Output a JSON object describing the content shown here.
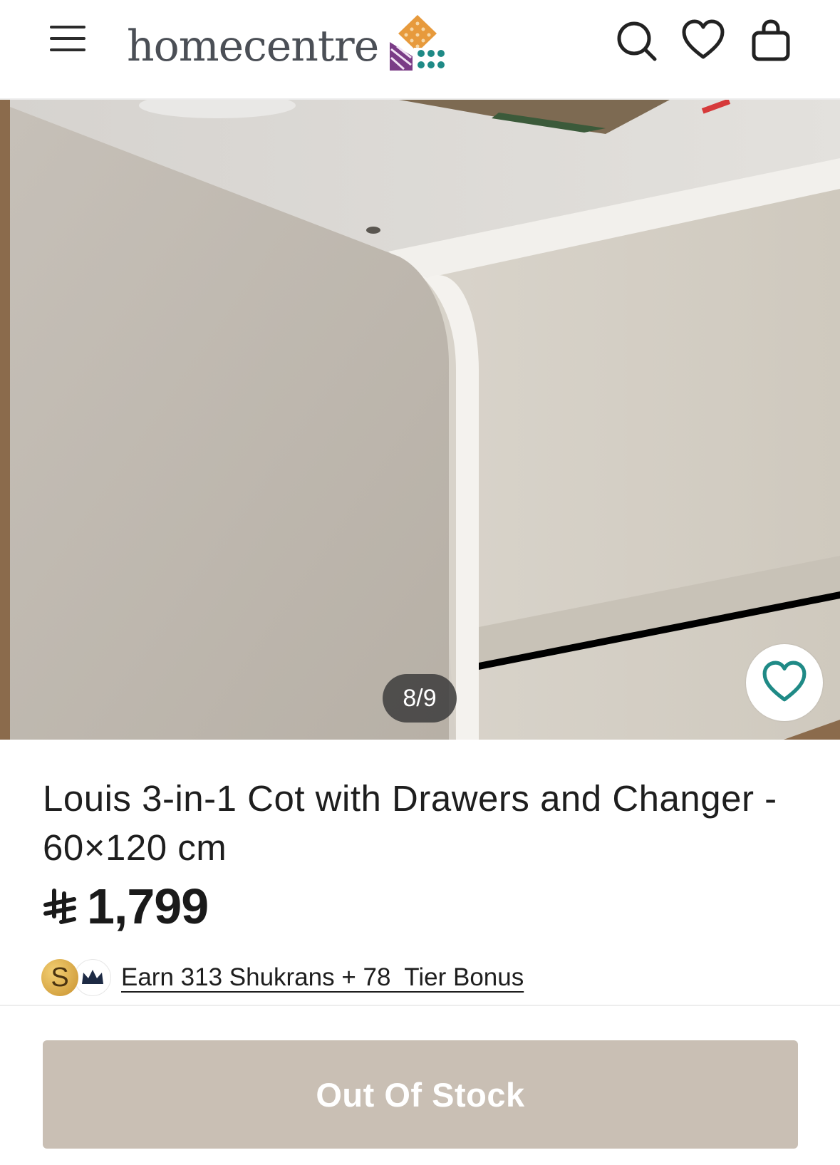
{
  "header": {
    "logo_text": "homecentre",
    "icons": [
      "menu-icon",
      "search-icon",
      "heart-icon",
      "bag-icon"
    ]
  },
  "gallery": {
    "counter": "8/9",
    "current_image": 8,
    "total_images": 9
  },
  "product": {
    "title": "Louis 3-in-1 Cot with Drawers and Changer - 60×120 cm",
    "currency_icon": "saudi-riyal-icon",
    "price": "1,799",
    "rewards": {
      "text": "Earn 313 Shukrans + 78  Tier Bonus",
      "coin_letter": "S"
    },
    "cta_label": "Out Of Stock"
  },
  "colors": {
    "accent_teal": "#1f8a86",
    "cta_disabled": "#c9bfb4",
    "text_dark": "#1e1e1e"
  }
}
